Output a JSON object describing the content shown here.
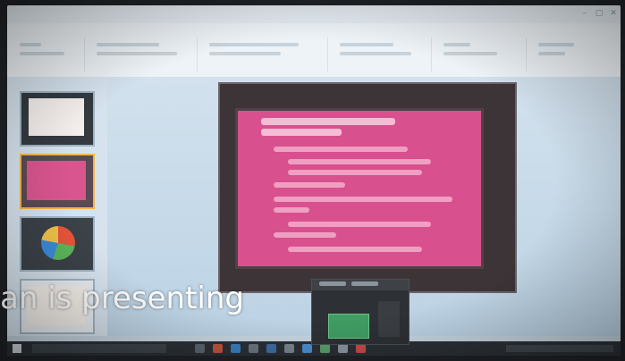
{
  "caption": {
    "text": "an is presenting"
  },
  "colors": {
    "slide_background": "#d9508e",
    "slide_frame": "#3d3438",
    "screen": "#dbe6ef",
    "taskbar": "#2b3036",
    "active_thumbnail_border": "#f2b54a"
  },
  "icons": {
    "window_controls": [
      "minimize-icon",
      "maximize-icon",
      "close-icon"
    ],
    "taskbar": [
      "windows-start-icon",
      "search-icon",
      "app-icon",
      "app-icon",
      "app-icon",
      "app-icon",
      "app-icon",
      "app-icon",
      "app-icon",
      "app-icon"
    ]
  }
}
